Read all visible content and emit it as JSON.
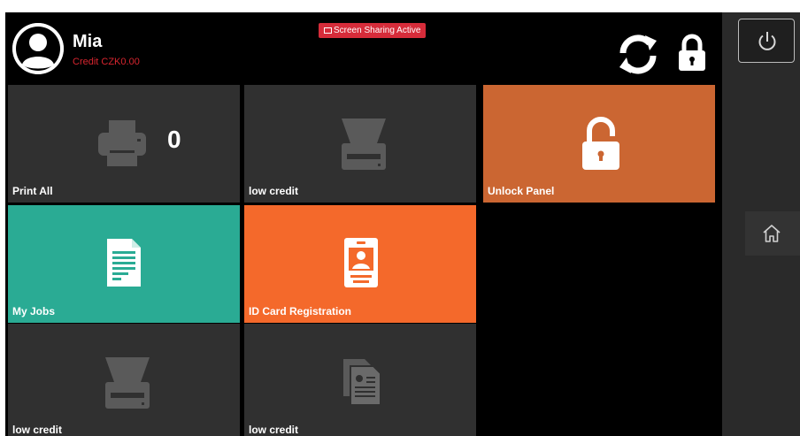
{
  "header": {
    "user_name": "Mia",
    "credit": "Credit CZK0.00",
    "screen_sharing_badge": "Screen Sharing Active",
    "refresh_icon": "refresh-icon",
    "lock_icon": "lock-icon"
  },
  "tiles": [
    {
      "label": "Print All",
      "icon": "printer-icon",
      "count": "0",
      "color": "#303030"
    },
    {
      "label": "low credit",
      "icon": "scanner-icon",
      "color": "#303030"
    },
    {
      "label": "Unlock Panel",
      "icon": "unlock-icon",
      "color": "#cb6632"
    },
    {
      "label": "My Jobs",
      "icon": "document-icon",
      "color": "#2aab94"
    },
    {
      "label": "ID Card Registration",
      "icon": "id-card-icon",
      "color": "#f4692b"
    },
    {
      "label": "low credit",
      "icon": "scanner-icon",
      "color": "#303030"
    },
    {
      "label": "low credit",
      "icon": "copy-icon",
      "color": "#303030"
    }
  ],
  "sidebar": {
    "power_icon": "power-icon",
    "home_icon": "home-icon"
  },
  "colors": {
    "accent_red": "#d62c3a",
    "credit_red": "#d8252f",
    "teal": "#2aab94",
    "orange": "#f4692b",
    "copper": "#cb6632",
    "tile_gray": "#303030"
  }
}
